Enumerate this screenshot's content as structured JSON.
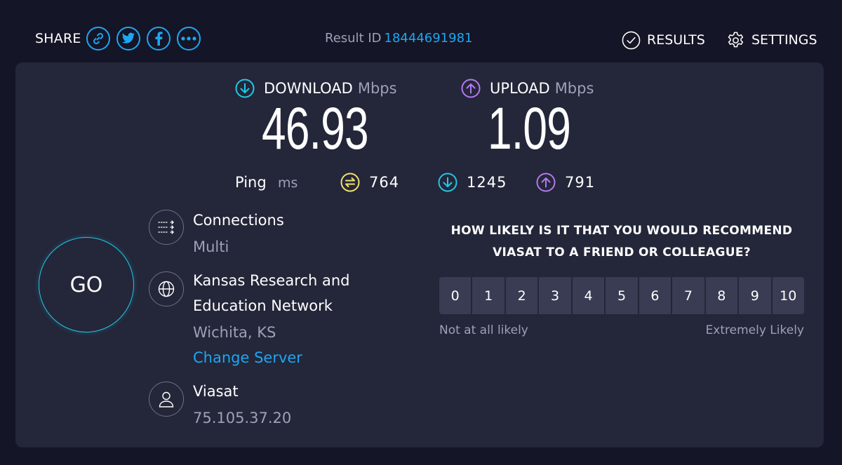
{
  "header": {
    "share_label": "SHARE",
    "share_icons": [
      "link-icon",
      "twitter-icon",
      "facebook-icon",
      "more-icon"
    ],
    "result_id_label": "Result ID",
    "result_id_value": "18444691981",
    "results_label": "RESULTS",
    "settings_label": "SETTINGS"
  },
  "download": {
    "label": "DOWNLOAD",
    "unit": "Mbps",
    "value": "46.93"
  },
  "upload": {
    "label": "UPLOAD",
    "unit": "Mbps",
    "value": "1.09"
  },
  "ping": {
    "label": "Ping",
    "unit": "ms",
    "idle": "764",
    "download": "1245",
    "upload": "791"
  },
  "go_label": "GO",
  "connections": {
    "title": "Connections",
    "value": "Multi"
  },
  "server": {
    "name_line1": "Kansas Research and",
    "name_line2": "Education Network",
    "location": "Wichita, KS",
    "change_label": "Change Server"
  },
  "provider": {
    "name": "Viasat",
    "ip": "75.105.37.20"
  },
  "survey": {
    "question_line1": "HOW LIKELY IS IT THAT YOU WOULD RECOMMEND",
    "question_line2": "VIASAT TO A FRIEND OR COLLEAGUE?",
    "options": [
      "0",
      "1",
      "2",
      "3",
      "4",
      "5",
      "6",
      "7",
      "8",
      "9",
      "10"
    ],
    "low_label": "Not at all likely",
    "high_label": "Extremely Likely"
  },
  "colors": {
    "background": "#141526",
    "panel": "#242639",
    "accent_blue": "#1ca7f2",
    "download_cyan": "#20c9e6",
    "upload_purple": "#b27aef",
    "ping_yellow": "#f2e36b",
    "muted_text": "#9da1b8",
    "rating_button": "#393c52"
  }
}
